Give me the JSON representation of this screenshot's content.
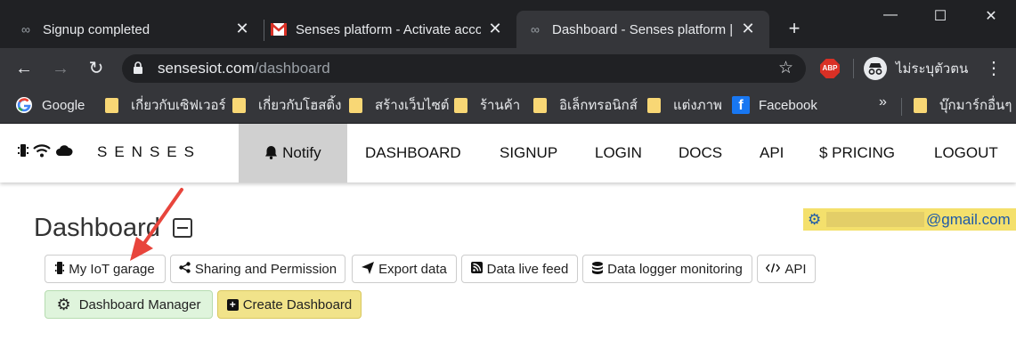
{
  "browser": {
    "tabs": [
      {
        "title": "Signup completed",
        "favicon": "loop-icon"
      },
      {
        "title": "Senses platform - Activate acco",
        "favicon": "gmail-icon"
      },
      {
        "title": "Dashboard - Senses platform |",
        "favicon": "loop-icon"
      }
    ],
    "close_glyph": "✕",
    "new_tab_glyph": "+",
    "window_controls": {
      "minimize": "—",
      "maximize": "☐",
      "close": "✕"
    },
    "url_host": "sensesiot.com",
    "url_path": "/dashboard",
    "abp_label": "ABP",
    "profile_label": "ไม่ระบุตัวตน",
    "bookmarks": [
      {
        "label": "Google",
        "icon": "google-icon"
      },
      {
        "label": "เกี่ยวกับเซิฟเวอร์",
        "icon": "folder-icon"
      },
      {
        "label": "เกี่ยวกับโฮสติ้ง",
        "icon": "folder-icon"
      },
      {
        "label": "สร้างเว็บไซต์",
        "icon": "folder-icon"
      },
      {
        "label": "ร้านค้า",
        "icon": "folder-icon"
      },
      {
        "label": "อิเล็กทรอนิกส์",
        "icon": "folder-icon"
      },
      {
        "label": "แต่งภาพ",
        "icon": "folder-icon"
      },
      {
        "label": "Facebook",
        "icon": "facebook-icon"
      }
    ],
    "bookmarks_overflow": "»",
    "other_bookmarks": "บุ๊กมาร์กอื่นๆ"
  },
  "site": {
    "brand": "SENSES",
    "nav": {
      "notify": "Notify",
      "dashboard": "DASHBOARD",
      "signup": "SIGNUP",
      "login": "LOGIN",
      "docs": "DOCS",
      "api": "API",
      "pricing": "$ PRICING",
      "logout": "LOGOUT"
    }
  },
  "main": {
    "title": "Dashboard",
    "email_domain": "@gmail.com",
    "buttons": {
      "iot_garage": "My IoT garage",
      "sharing": "Sharing and Permission",
      "export": "Export data",
      "live_feed": "Data live feed",
      "logger": "Data logger monitoring",
      "api": "API",
      "manager": "Dashboard Manager",
      "create": "Create Dashboard"
    }
  },
  "colors": {
    "chrome_dark": "#202124",
    "chrome_toolbar": "#35363a",
    "notify_bg": "#d0d0d0",
    "email_badge": "#f4e06c",
    "manager_btn": "#dff4dc",
    "create_btn": "#f1e38a",
    "annotation_arrow": "#e8453c"
  }
}
